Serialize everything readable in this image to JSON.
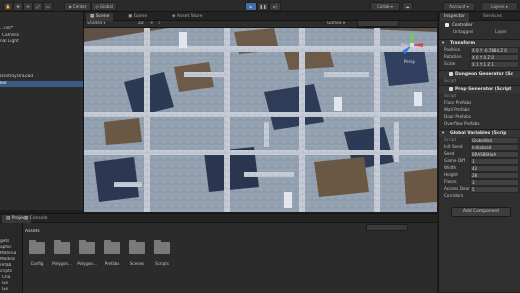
{
  "toolbar": {
    "center_label": "Center",
    "global_label": "Global",
    "collab_label": "Collab",
    "account_label": "Account",
    "layers_label": "Layers"
  },
  "hierarchy": {
    "rows": [
      "...ner*",
      "Camera",
      "nal Light",
      "",
      "",
      "DestroyOnLoad",
      "ller"
    ]
  },
  "scene": {
    "tabs": [
      "Scene",
      "Game",
      "Asset Store"
    ],
    "shading_mode": "Shaded",
    "dim_label": "2D",
    "gizmos_label": "Gizmos",
    "persp_label": "Persp"
  },
  "project": {
    "tabs": [
      "Project",
      "Console"
    ],
    "assets_label": "Assets",
    "tree": [
      "gets",
      "aphic",
      "Materia",
      "Models",
      "refab",
      "cripts",
      "Cha",
      "Ge",
      "Ge"
    ],
    "folders": [
      "Config",
      "Polygon...",
      "Polygon...",
      "Prefabs",
      "Scenes",
      "Scripts"
    ]
  },
  "inspector": {
    "tabs": [
      "Inspector",
      "Services"
    ],
    "object_name": "Controller",
    "tag": "Untagged",
    "layer_label": "Layer",
    "transform": {
      "title": "Transform",
      "rows": [
        {
          "label": "Position",
          "value": "X 0  Y -0.7884  Z 0"
        },
        {
          "label": "Rotation",
          "value": "X 0  Y 0  Z 0"
        },
        {
          "label": "Scale",
          "value": "X 1  Y 1  Z 1"
        }
      ]
    },
    "components": [
      "Dungeon Generator (Sc",
      "Prop Generator (Script"
    ],
    "script_label": "Script",
    "prefab_rows": [
      "Floor Prefabs",
      "Wall Prefabs",
      "Door Prefabs",
      "Overflow Prefabs"
    ],
    "global_vars": {
      "title": "Global Variables (Scrip",
      "rows": [
        {
          "label": "Script",
          "value": "GlobalVari"
        },
        {
          "label": "Init Seed",
          "value": "Initialized"
        },
        {
          "label": "Seed",
          "value": "BRASB6HoA"
        },
        {
          "label": "Game Diff",
          "value": "1"
        },
        {
          "label": "Width",
          "value": "42"
        },
        {
          "label": "Height",
          "value": "28"
        },
        {
          "label": "Floors",
          "value": "3"
        },
        {
          "label": "Access Door P",
          "value": "5"
        }
      ],
      "corridors_label": "Corridors"
    },
    "add_component_label": "Add Component"
  }
}
